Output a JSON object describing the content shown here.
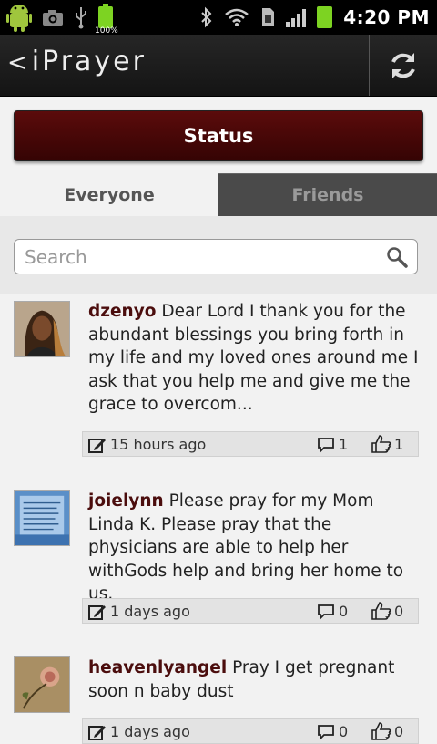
{
  "statusbar": {
    "time": "4:20 PM",
    "battery_label": "100%",
    "icons": [
      "android-icon",
      "camera-icon",
      "usb-icon",
      "battery-full-icon",
      "bluetooth-icon",
      "wifi-icon",
      "sd-card-icon",
      "signal-icon",
      "battery-icon"
    ]
  },
  "appbar": {
    "back_glyph": "<",
    "title": "iPrayer",
    "refresh_icon": "refresh-icon"
  },
  "status_button": {
    "label": "Status"
  },
  "tabs": [
    {
      "label": "Everyone",
      "active": true
    },
    {
      "label": "Friends",
      "active": false
    }
  ],
  "search": {
    "placeholder": "Search",
    "value": ""
  },
  "posts": [
    {
      "username": "dzenyo",
      "text": "Dear Lord I thank you for the abundant blessings you bring forth in my life and my loved ones around me I ask that you help me and give me the grace to overcom...",
      "time": "15 hours ago",
      "comments": "1",
      "likes": "1"
    },
    {
      "username": "joielynn",
      "text": "Please pray for my Mom Linda K. Please pray that the physicians are able to help her withGods help and bring her home to us.",
      "time": "1 days ago",
      "comments": "0",
      "likes": "0"
    },
    {
      "username": "heavenlyangel",
      "text": "Pray I get pregnant soon n baby dust",
      "time": "1 days ago",
      "comments": "0",
      "likes": "0"
    }
  ],
  "colors": {
    "accent_dark_red": "#4b0d0d",
    "status_button_red": "#5b0b0b",
    "battery_green": "#7dd322"
  }
}
